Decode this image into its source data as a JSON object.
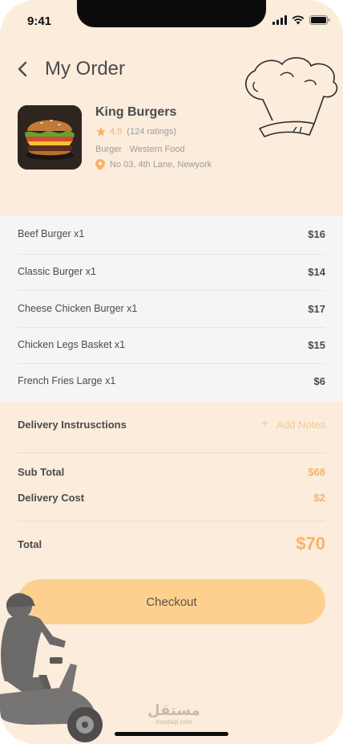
{
  "status_bar": {
    "time": "9:41"
  },
  "header": {
    "title": "My Order"
  },
  "restaurant": {
    "name": "King Burgers",
    "rating": "4.9",
    "rating_count": "(124 ratings)",
    "category": "Burger",
    "cuisine": "Western Food",
    "address": "No 03, 4th Lane, Newyork"
  },
  "items": [
    {
      "name": "Beef Burger x1",
      "price": "$16"
    },
    {
      "name": "Classic Burger x1",
      "price": "$14"
    },
    {
      "name": "Cheese Chicken Burger x1",
      "price": "$17"
    },
    {
      "name": "Chicken Legs Basket x1",
      "price": "$15"
    },
    {
      "name": "French Fries Large x1",
      "price": "$6"
    }
  ],
  "delivery": {
    "label": "Delivery Instrusctions",
    "add_notes": "Add Notes"
  },
  "summary": {
    "subtotal_label": "Sub Total",
    "subtotal_value": "$68",
    "delivery_label": "Delivery Cost",
    "delivery_value": "$2",
    "total_label": "Total",
    "total_value": "$70"
  },
  "checkout_label": "Checkout",
  "watermark": {
    "arabic": "مستقل",
    "latin": "mostaql.com"
  },
  "colors": {
    "accent": "#f7b36a",
    "background": "#fbecdc",
    "button": "#fdd08f",
    "text": "#4a4b4d"
  },
  "icons": [
    "chevron-left-icon",
    "star-icon",
    "location-pin-icon",
    "plus-icon",
    "chef-hat-icon",
    "signal-icon",
    "wifi-icon",
    "battery-icon"
  ]
}
